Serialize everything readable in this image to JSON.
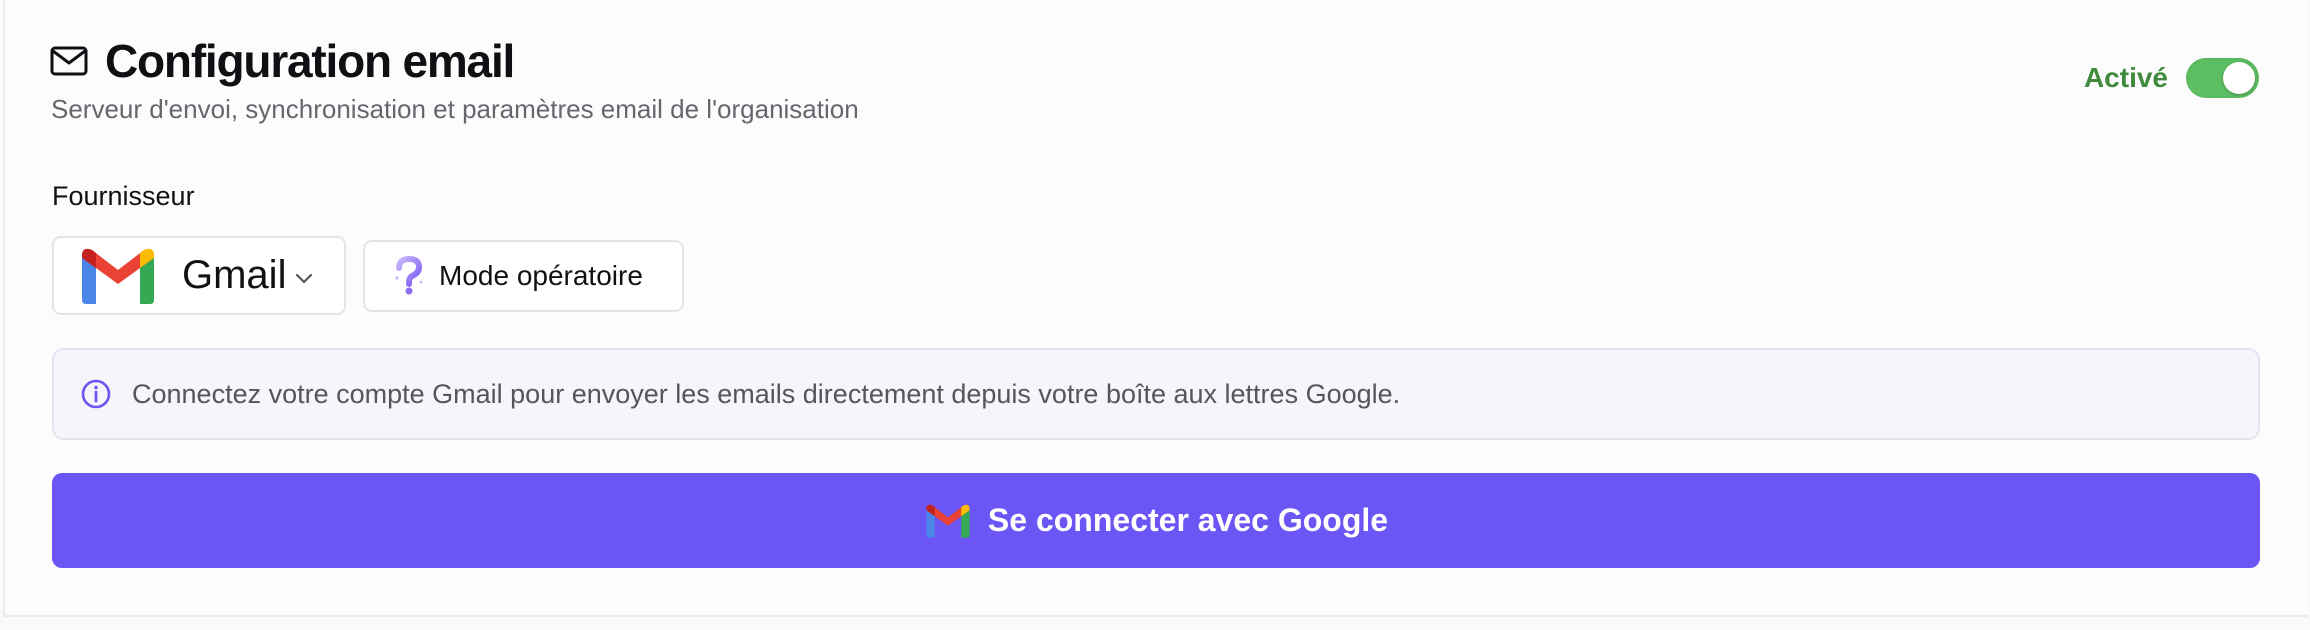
{
  "header": {
    "title": "Configuration email",
    "subtitle": "Serveur d'envoi, synchronisation et paramètres email de l'organisation",
    "icon": "mail-icon",
    "toggle_label": "Activé",
    "toggle_on": true
  },
  "provider": {
    "label": "Fournisseur",
    "selected": "Gmail",
    "icon": "gmail-logo"
  },
  "mode_button": {
    "label": "Mode opératoire",
    "icon": "question-icon"
  },
  "info": {
    "icon": "info-icon",
    "text": "Connectez votre compte Gmail pour envoyer les emails directement depuis votre boîte aux lettres Google."
  },
  "connect_button": {
    "label": "Se connecter avec Google",
    "icon": "gmail-logo"
  },
  "colors": {
    "accent": "#6b55f5",
    "toggle_on": "#5cbd61",
    "toggle_label": "#3f8a3d",
    "info_bg": "#f6f5fb"
  }
}
